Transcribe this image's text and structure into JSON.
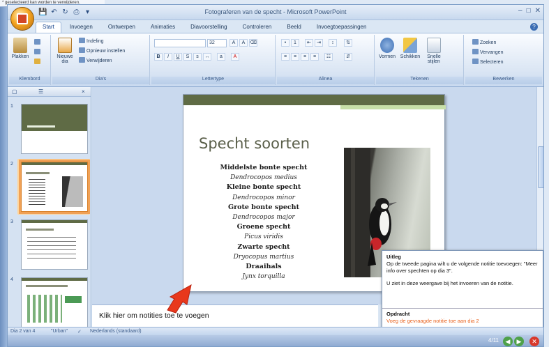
{
  "outer": {
    "strip_text": "* geselecteerd kan worden te verwijderen."
  },
  "window": {
    "title": "Fotograferen van de specht - Microsoft PowerPoint"
  },
  "qat": {
    "icons": [
      "save-icon",
      "undo-icon",
      "redo-icon",
      "print-icon"
    ]
  },
  "tabs": [
    {
      "label": "Start",
      "active": true
    },
    {
      "label": "Invoegen"
    },
    {
      "label": "Ontwerpen"
    },
    {
      "label": "Animaties"
    },
    {
      "label": "Diavoorstelling"
    },
    {
      "label": "Controleren"
    },
    {
      "label": "Beeld"
    },
    {
      "label": "Invoegtoepassingen"
    }
  ],
  "ribbon": {
    "clipboard": {
      "label": "Klembord",
      "paste": "Plakken"
    },
    "slides": {
      "label": "Dia's",
      "new_slide": "Nieuwe dia",
      "layout": "Indeling",
      "reset": "Opnieuw instellen",
      "delete": "Verwijderen"
    },
    "font": {
      "label": "Lettertype",
      "size": "32"
    },
    "paragraph": {
      "label": "Alinea"
    },
    "drawing": {
      "label": "Tekenen",
      "shapes": "Vormen",
      "arrange": "Schikken",
      "quick_styles": "Snelle stijlen"
    },
    "editing": {
      "label": "Bewerken",
      "find": "Zoeken",
      "replace": "Vervangen",
      "select": "Selecteren"
    }
  },
  "slide_pane": {
    "thumbnails": [
      {
        "number": "1"
      },
      {
        "number": "2",
        "selected": true
      },
      {
        "number": "3"
      },
      {
        "number": "4"
      }
    ]
  },
  "slide": {
    "title": "Specht soorten",
    "species": [
      {
        "common": "Middelste bonte specht",
        "latin": "Dendrocopos medius"
      },
      {
        "common": "Kleine bonte specht",
        "latin": "Dendrocopos minor"
      },
      {
        "common": "Grote bonte specht",
        "latin": "Dendrocopos major"
      },
      {
        "common": "Groene specht",
        "latin": "Picus viridis"
      },
      {
        "common": "Zwarte specht",
        "latin": "Dryocopus martius"
      },
      {
        "common": "Draaihals",
        "latin": "Jynx torquilla"
      }
    ]
  },
  "notes": {
    "placeholder": "Klik hier om notities toe te voegen"
  },
  "callout": {
    "heading": "Uitleg",
    "text1": "Op de tweede pagina wilt u de volgende notitie toevoegen: \"Meer info over spechten op dia 3\".",
    "text2": "U ziet in deze weergave bij het invoeren van de notitie.",
    "task_heading": "Opdracht",
    "task_text": "Voeg de gevraagde notitie toe aan dia 2"
  },
  "status": {
    "slide_info": "Dia 2 van 4",
    "theme": "\"Urban\"",
    "language": "Nederlands (standaard)"
  },
  "bottom": {
    "counter": "4/11"
  },
  "colors": {
    "selection": "#f0a156",
    "title_band": "#5f6b45",
    "arrow": "#e8381c"
  }
}
